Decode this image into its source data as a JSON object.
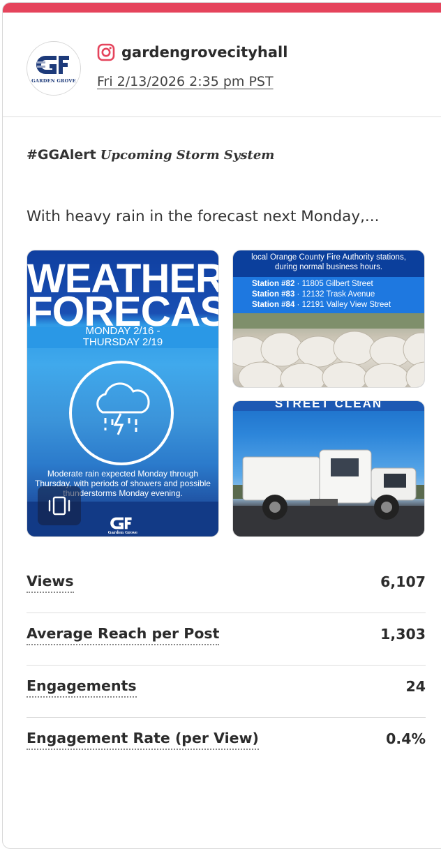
{
  "post": {
    "account_handle": "gardengrovecityhall",
    "platform_icon": "instagram-icon",
    "timestamp": "Fri 2/13/2026 2:35 pm PST",
    "avatar_text": "GARDEN GROVE",
    "title_tag": "#GGAlert",
    "title_italic": "Upcoming Storm System",
    "caption": "With heavy rain in the forecast next Monday,...",
    "accent_color": "#e5445c"
  },
  "media": {
    "main": {
      "line1": "WEATHER",
      "line2": "FORECAST",
      "dates": "MONDAY 2/16 -\nTHURSDAY 2/19",
      "description": "Moderate rain expected Monday through Thursday, with periods of showers and possible thunderstorms Monday evening.",
      "logo_text": "Garden Grove",
      "carousel_icon": "carousel-icon"
    },
    "top": {
      "line1": "local Orange County Fire Authority stations,",
      "line2": "during normal business hours.",
      "stations": [
        {
          "name": "Station #82",
          "address": "11805 Gilbert Street"
        },
        {
          "name": "Station #83",
          "address": "12132 Trask Avenue"
        },
        {
          "name": "Station #84",
          "address": "12191 Valley View Street"
        }
      ]
    },
    "bottom": {
      "title": "STREET CLEAN"
    }
  },
  "stats": [
    {
      "label": "Views",
      "value": "6,107"
    },
    {
      "label": "Average Reach per Post",
      "value": "1,303"
    },
    {
      "label": "Engagements",
      "value": "24"
    },
    {
      "label": "Engagement Rate (per View)",
      "value": "0.4%"
    }
  ]
}
